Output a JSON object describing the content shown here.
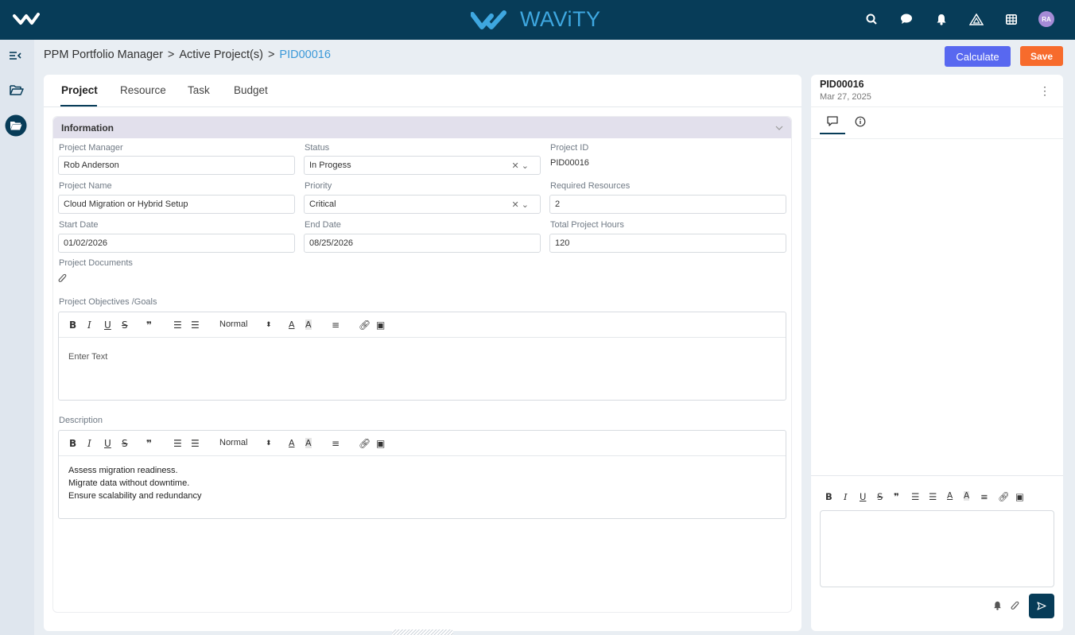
{
  "brand": {
    "name": "WAViTY"
  },
  "topbar": {
    "avatar_initials": "RA"
  },
  "breadcrumb": {
    "part1": "PPM Portfolio Manager",
    "sep": ">",
    "part2": "Active Project(s)",
    "current": "PID00016"
  },
  "actions": {
    "calculate_label": "Calculate",
    "save_label": "Save"
  },
  "tabs": [
    {
      "label": "Project"
    },
    {
      "label": "Resource"
    },
    {
      "label": "Task"
    },
    {
      "label": "Budget"
    }
  ],
  "info": {
    "title": "Information",
    "project_manager_label": "Project Manager",
    "project_manager_value": "Rob Anderson",
    "status_label": "Status",
    "status_value": "In Progess",
    "project_id_label": "Project ID",
    "project_id_value": "PID00016",
    "project_name_label": "Project Name",
    "project_name_value": "Cloud Migration or Hybrid Setup",
    "priority_label": "Priority",
    "priority_value": "Critical",
    "required_resources_label": "Required Resources",
    "required_resources_value": "2",
    "start_date_label": "Start Date",
    "start_date_value": "01/02/2026",
    "end_date_label": "End Date",
    "end_date_value": "08/25/2026",
    "total_hours_label": "Total Project Hours",
    "total_hours_value": "120",
    "documents_label": "Project Documents",
    "objectives_label": "Project Objectives /Goals",
    "objectives_placeholder": "Enter Text",
    "description_label": "Description",
    "description_lines": [
      "Assess migration readiness.",
      "Migrate data without downtime.",
      "Ensure scalability and redundancy"
    ]
  },
  "editor_toolbar": {
    "heading": "Normal"
  },
  "side": {
    "id": "PID00016",
    "date": "Mar 27, 2025"
  }
}
